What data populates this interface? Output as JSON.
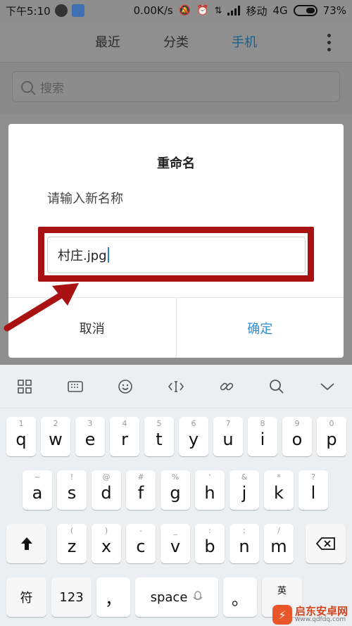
{
  "status_bar": {
    "time": "下午5:10",
    "speed": "0.00K/s",
    "carrier": "移动",
    "network": "4G",
    "battery": "73%"
  },
  "header": {
    "tabs": [
      {
        "label": "最近"
      },
      {
        "label": "分类"
      },
      {
        "label": "手机",
        "active": true
      }
    ]
  },
  "search": {
    "placeholder": "搜索"
  },
  "dialog": {
    "title": "重命名",
    "message": "请输入新名称",
    "input_value": "村庄.jpg",
    "cancel_label": "取消",
    "ok_label": "确定",
    "highlight_color": "#a81212",
    "accent_color": "#2b8fd6"
  },
  "keyboard": {
    "row1": [
      {
        "hint": "1",
        "key": "q"
      },
      {
        "hint": "2",
        "key": "w"
      },
      {
        "hint": "3",
        "key": "e"
      },
      {
        "hint": "4",
        "key": "r"
      },
      {
        "hint": "5",
        "key": "t"
      },
      {
        "hint": "6",
        "key": "y"
      },
      {
        "hint": "7",
        "key": "u"
      },
      {
        "hint": "8",
        "key": "i"
      },
      {
        "hint": "9",
        "key": "o"
      },
      {
        "hint": "0",
        "key": "p"
      }
    ],
    "row2": [
      {
        "hint": "~",
        "key": "a"
      },
      {
        "hint": "!",
        "key": "s"
      },
      {
        "hint": "@",
        "key": "d"
      },
      {
        "hint": "#",
        "key": "f"
      },
      {
        "hint": "%",
        "key": "g"
      },
      {
        "hint": "'",
        "key": "h"
      },
      {
        "hint": "&",
        "key": "j"
      },
      {
        "hint": "*",
        "key": "k"
      },
      {
        "hint": "?",
        "key": "l"
      }
    ],
    "row3": [
      {
        "hint": "(",
        "key": "z"
      },
      {
        "hint": ")",
        "key": "x"
      },
      {
        "hint": "-",
        "key": "c"
      },
      {
        "hint": "_",
        "key": "v"
      },
      {
        "hint": ":",
        "key": "b"
      },
      {
        "hint": ";",
        "key": "n"
      },
      {
        "hint": "/",
        "key": "m"
      }
    ],
    "symbol_label": "符",
    "num_label": "123",
    "comma_label": "，",
    "space_label": "space",
    "period_label": "。",
    "lang_label": "英"
  },
  "watermark": {
    "name": "启东安卓网",
    "url": "www.qdfdq.com"
  }
}
